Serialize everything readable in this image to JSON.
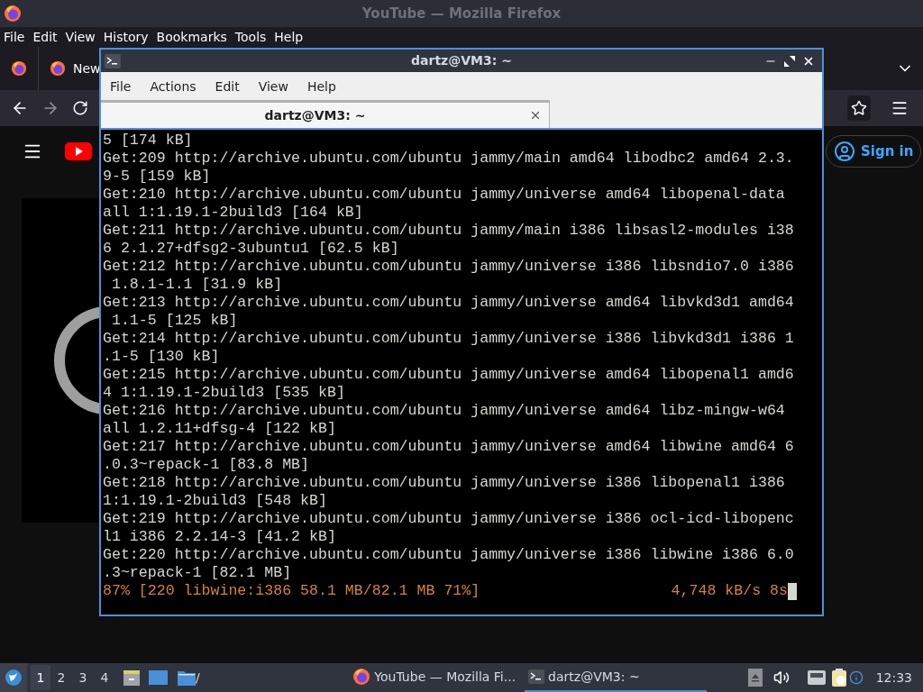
{
  "browser": {
    "title": "YouTube — Mozilla Firefox",
    "menu": [
      "File",
      "Edit",
      "View",
      "History",
      "Bookmarks",
      "Tools",
      "Help"
    ],
    "tab": {
      "label": "New"
    },
    "page": {
      "sign_in": "Sign in"
    }
  },
  "terminal": {
    "title": "dartz@VM3: ~",
    "menu": [
      "File",
      "Actions",
      "Edit",
      "View",
      "Help"
    ],
    "tabs": [
      {
        "label": "dartz@VM3: ~",
        "selected": true
      }
    ],
    "lines": [
      "5 [174 kB]",
      "Get:209 http://archive.ubuntu.com/ubuntu jammy/main amd64 libodbc2 amd64 2.3.",
      "9-5 [159 kB]",
      "Get:210 http://archive.ubuntu.com/ubuntu jammy/universe amd64 libopenal-data",
      "all 1:1.19.1-2build3 [164 kB]",
      "Get:211 http://archive.ubuntu.com/ubuntu jammy/main i386 libsasl2-modules i38",
      "6 2.1.27+dfsg2-3ubuntu1 [62.5 kB]",
      "Get:212 http://archive.ubuntu.com/ubuntu jammy/universe i386 libsndio7.0 i386",
      " 1.8.1-1.1 [31.9 kB]",
      "Get:213 http://archive.ubuntu.com/ubuntu jammy/universe amd64 libvkd3d1 amd64",
      " 1.1-5 [125 kB]",
      "Get:214 http://archive.ubuntu.com/ubuntu jammy/universe i386 libvkd3d1 i386 1",
      ".1-5 [130 kB]",
      "Get:215 http://archive.ubuntu.com/ubuntu jammy/universe amd64 libopenal1 amd6",
      "4 1:1.19.1-2build3 [535 kB]",
      "Get:216 http://archive.ubuntu.com/ubuntu jammy/universe amd64 libz-mingw-w64",
      "all 1.2.11+dfsg-4 [122 kB]",
      "Get:217 http://archive.ubuntu.com/ubuntu jammy/universe amd64 libwine amd64 6",
      ".0.3~repack-1 [83.8 MB]",
      "Get:218 http://archive.ubuntu.com/ubuntu jammy/universe i386 libopenal1 i386",
      "1:1.19.1-2build3 [548 kB]",
      "Get:219 http://archive.ubuntu.com/ubuntu jammy/universe i386 ocl-icd-libopenc",
      "l1 i386 2.2.14-3 [41.2 kB]",
      "Get:220 http://archive.ubuntu.com/ubuntu jammy/universe i386 libwine i386 6.0",
      ".3~repack-1 [82.1 MB]"
    ],
    "progress": {
      "status": "87% [220 libwine:i386 58.1 MB/82.1 MB 71%]",
      "speed": "4,748 kB/s 8s"
    }
  },
  "taskbar": {
    "workspaces": [
      {
        "label": "1",
        "selected": true
      },
      {
        "label": "2",
        "selected": false
      },
      {
        "label": "3",
        "selected": false
      },
      {
        "label": "4",
        "selected": false
      }
    ],
    "folder_label": "/",
    "tasks": [
      {
        "kind": "browser",
        "label": "YouTube — Mozilla Fi...",
        "selected": false
      },
      {
        "kind": "terminal",
        "label": "dartz@VM3: ~",
        "selected": true
      }
    ],
    "clock": "12:33"
  }
}
